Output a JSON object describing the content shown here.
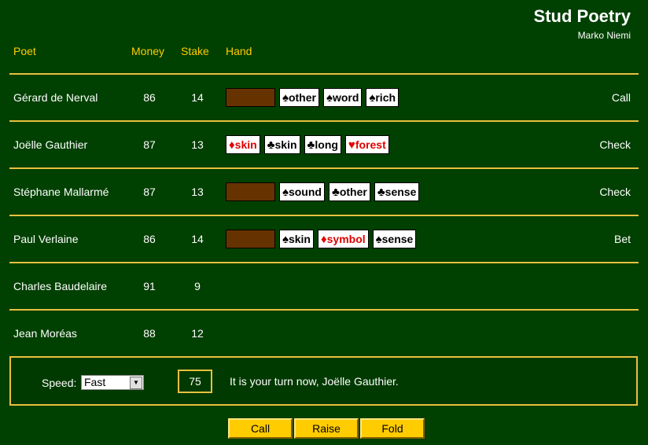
{
  "app": {
    "title": "Stud Poetry",
    "author": "Marko Niemi"
  },
  "headers": {
    "poet": "Poet",
    "money": "Money",
    "stake": "Stake",
    "hand": "Hand"
  },
  "players": [
    {
      "name": "Gérard de Nerval",
      "money": "86",
      "stake": "14",
      "action": "Call",
      "hand": [
        {
          "hidden": true
        },
        {
          "suit": "♠",
          "word": "other",
          "red": false
        },
        {
          "suit": "♠",
          "word": "word",
          "red": false
        },
        {
          "suit": "♠",
          "word": "rich",
          "red": false
        }
      ]
    },
    {
      "name": "Joëlle Gauthier",
      "money": "87",
      "stake": "13",
      "action": "Check",
      "hand": [
        {
          "suit": "♦",
          "word": "skin",
          "red": true
        },
        {
          "suit": "♣",
          "word": "skin",
          "red": false
        },
        {
          "suit": "♣",
          "word": "long",
          "red": false
        },
        {
          "suit": "♥",
          "word": "forest",
          "red": true
        }
      ]
    },
    {
      "name": "Stéphane Mallarmé",
      "money": "87",
      "stake": "13",
      "action": "Check",
      "hand": [
        {
          "hidden": true
        },
        {
          "suit": "♠",
          "word": "sound",
          "red": false
        },
        {
          "suit": "♣",
          "word": "other",
          "red": false
        },
        {
          "suit": "♣",
          "word": "sense",
          "red": false
        }
      ]
    },
    {
      "name": "Paul Verlaine",
      "money": "86",
      "stake": "14",
      "action": "Bet",
      "hand": [
        {
          "hidden": true
        },
        {
          "suit": "♠",
          "word": "skin",
          "red": false
        },
        {
          "suit": "♦",
          "word": "symbol",
          "red": true
        },
        {
          "suit": "♠",
          "word": "sense",
          "red": false
        }
      ]
    },
    {
      "name": "Charles Baudelaire",
      "money": "91",
      "stake": "9",
      "action": "",
      "hand": []
    },
    {
      "name": "Jean Moréas",
      "money": "88",
      "stake": "12",
      "action": "",
      "hand": []
    }
  ],
  "controls": {
    "speed_label": "Speed:",
    "speed_value": "Fast",
    "pot": "75",
    "message": "It is your turn now, Joëlle Gauthier."
  },
  "buttons": {
    "call": "Call",
    "raise": "Raise",
    "fold": "Fold"
  }
}
